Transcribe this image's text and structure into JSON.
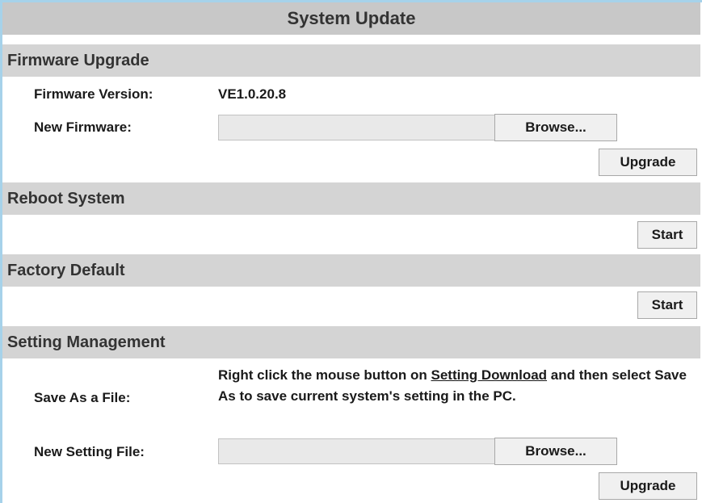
{
  "title": "System Update",
  "firmware": {
    "section": "Firmware Upgrade",
    "version_label": "Firmware Version:",
    "version_value": "VE1.0.20.8",
    "new_label": "New Firmware:",
    "browse_label": "Browse...",
    "upgrade_label": "Upgrade"
  },
  "reboot": {
    "section": "Reboot System",
    "start_label": "Start"
  },
  "factory": {
    "section": "Factory Default",
    "start_label": "Start"
  },
  "settings": {
    "section": "Setting Management",
    "save_label": "Save As a File:",
    "desc_before": "Right click the mouse button on ",
    "desc_link": "Setting Download",
    "desc_after": " and then select Save As to save current system's setting in the PC.",
    "new_label": "New Setting File:",
    "browse_label": "Browse...",
    "upgrade_label": "Upgrade"
  }
}
